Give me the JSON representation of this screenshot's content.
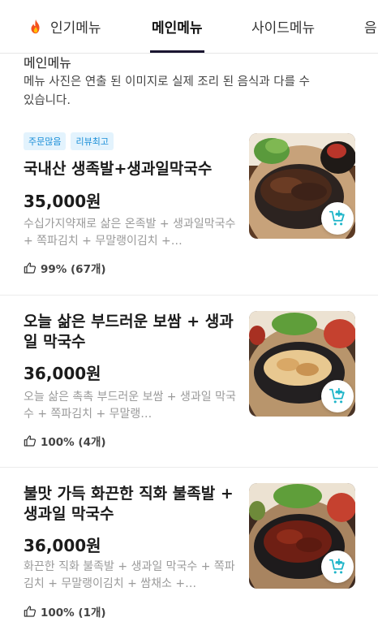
{
  "tabs": [
    {
      "label": "인기메뉴",
      "icon": "fire-icon"
    },
    {
      "label": "메인메뉴"
    },
    {
      "label": "사이드메뉴"
    },
    {
      "label": "음"
    }
  ],
  "active_tab": "메인메뉴",
  "section": {
    "title": "메인메뉴",
    "description": "메뉴 사진은 연출 된 이미지로 실제 조리 된 음식과 다를 수 있습니다."
  },
  "items": [
    {
      "badges": [
        "주문많음",
        "리뷰최고"
      ],
      "name": "국내산 생족발+생과일막국수",
      "price": "35,000원",
      "description": "수십가지약재로 삶은 온족발 + 생과일막국수 + 쪽파김치 + 무말랭이김치 +…",
      "review": "99% (67개)"
    },
    {
      "badges": [],
      "name": "오늘 삶은 부드러운 보쌈 + 생과일 막국수",
      "price": "36,000원",
      "description": "오늘 삶은 촉촉 부드러운 보쌈 + 생과일 막국수 + 쪽파김치 + 무말랭…",
      "review": "100% (4개)"
    },
    {
      "badges": [],
      "name": "불맛 가득 화끈한 직화 불족발 + 생과일 막국수",
      "price": "36,000원",
      "description": "화끈한 직화 불족발 + 생과일 막국수 + 쪽파김치 + 무말랭이김치 + 쌈채소 +…",
      "review": "100% (1개)"
    }
  ],
  "colors": {
    "badge_bg": "#e3f3fd",
    "badge_text": "#1a8fd8",
    "cart_icon": "#1fb5c9",
    "tab_underline": "#1a1530"
  }
}
